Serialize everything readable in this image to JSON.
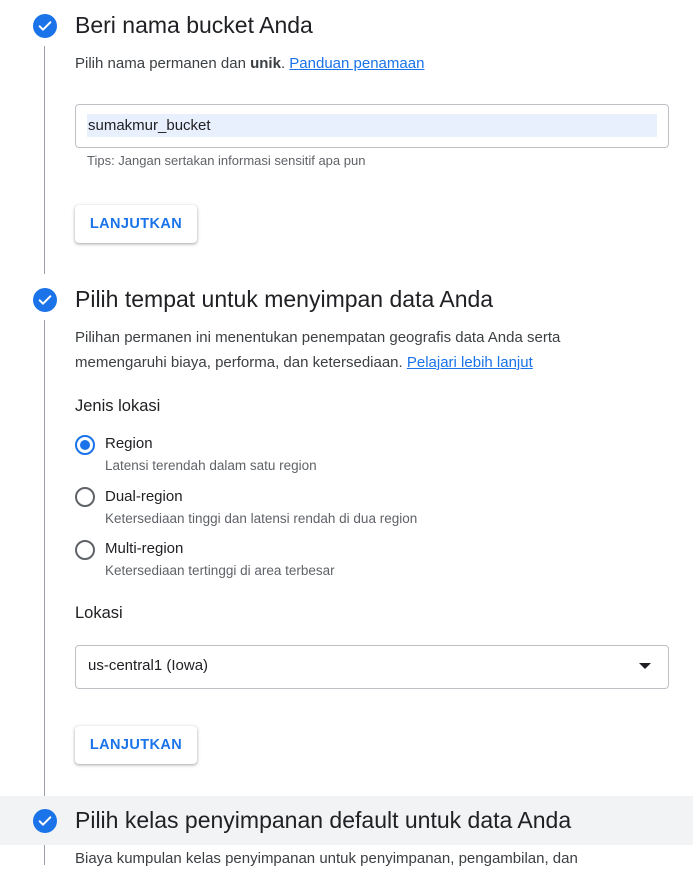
{
  "step1": {
    "title": "Beri nama bucket Anda",
    "desc_prefix": "Pilih nama permanen dan ",
    "desc_bold": "unik",
    "desc_suffix": ". ",
    "link": "Panduan penamaan",
    "input_value": "sumakmur_bucket",
    "hint": "Tips: Jangan sertakan informasi sensitif apa pun",
    "button": "LANJUTKAN"
  },
  "step2": {
    "title": "Pilih tempat untuk menyimpan data Anda",
    "desc_line1": "Pilihan permanen ini menentukan penempatan geografis data Anda serta",
    "desc_line2": "memengaruhi biaya, performa, dan ketersediaan. ",
    "link": "Pelajari lebih lanjut",
    "location_type_label": "Jenis lokasi",
    "options": [
      {
        "label": "Region",
        "sub": "Latensi terendah dalam satu region",
        "selected": true
      },
      {
        "label": "Dual-region",
        "sub": "Ketersediaan tinggi dan latensi rendah di dua region",
        "selected": false
      },
      {
        "label": "Multi-region",
        "sub": "Ketersediaan tertinggi di area terbesar",
        "selected": false
      }
    ],
    "location_label": "Lokasi",
    "location_value": "us-central1 (Iowa)",
    "button": "LANJUTKAN"
  },
  "step3": {
    "title": "Pilih kelas penyimpanan default untuk data Anda",
    "desc": "Biaya kumpulan kelas penyimpanan untuk penyimpanan, pengambilan, dan"
  },
  "colors": {
    "accent": "#1a73e8",
    "text": "#202124",
    "secondary_text": "#5f6368"
  }
}
